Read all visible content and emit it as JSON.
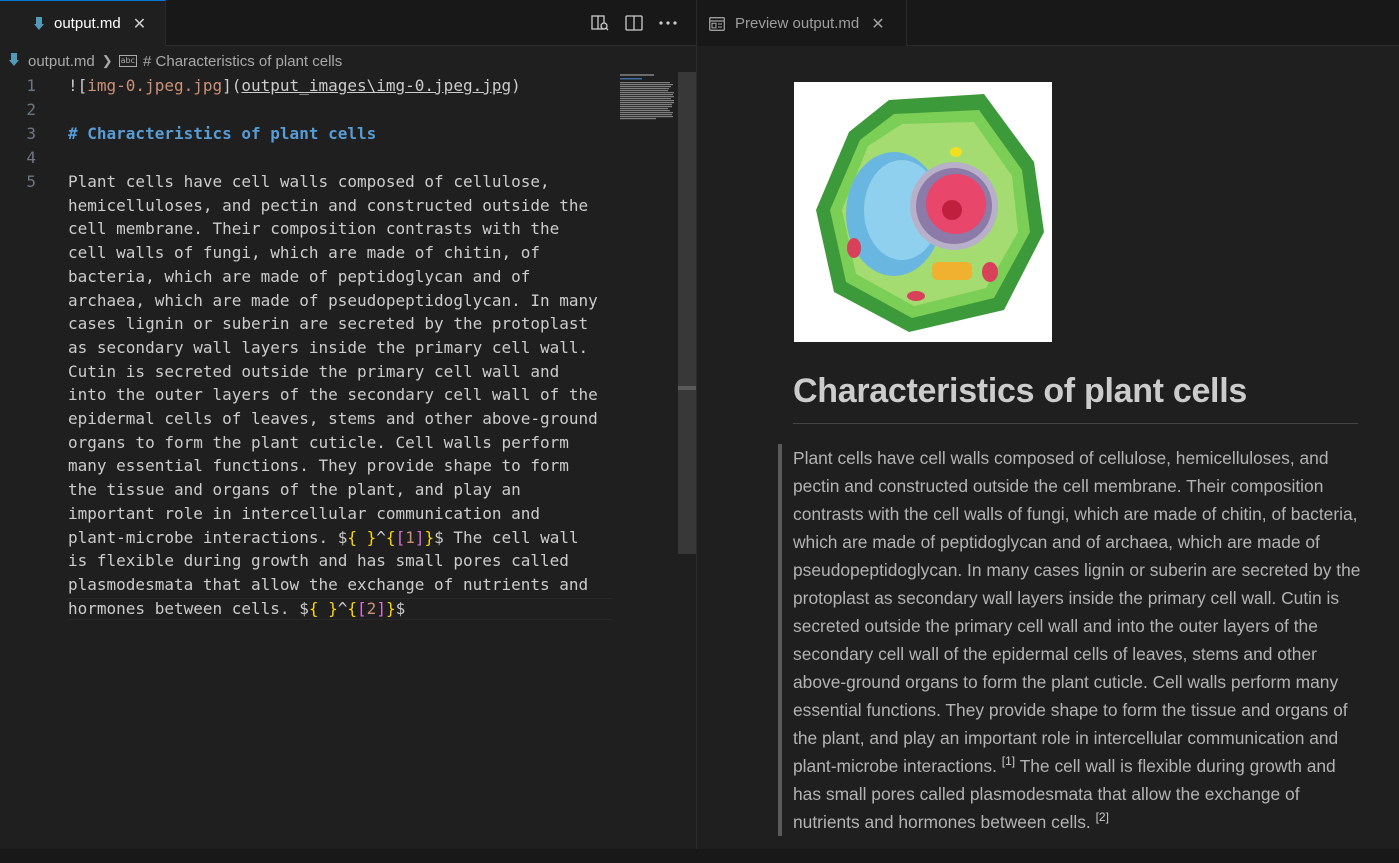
{
  "editor_tab": {
    "label": "output.md",
    "close": "✕"
  },
  "preview_tab": {
    "label": "Preview output.md",
    "close": "✕"
  },
  "breadcrumb": {
    "file": "output.md",
    "symbol": "# Characteristics of plant cells",
    "symbol_badge": "abc"
  },
  "editor": {
    "lines": [
      {
        "num": "1"
      },
      {
        "num": "2"
      },
      {
        "num": "3"
      },
      {
        "num": "4"
      },
      {
        "num": "5"
      }
    ],
    "line1": {
      "bang": "![",
      "alt": "img-0.jpeg.jpg",
      "mid": "](",
      "url": "output_images\\img-0.jpeg.jpg",
      "end": ")"
    },
    "line3": "# Characteristics of plant cells",
    "para": [
      "Plant cells have cell walls composed of cellulose,",
      "hemicelluloses, and pectin and constructed outside the",
      "cell membrane. Their composition contrasts with the",
      "cell walls of fungi, which are made of chitin, of",
      "bacteria, which are made of peptidoglycan and of",
      "archaea, which are made of pseudopeptidoglycan. In many",
      "cases lignin or suberin are secreted by the protoplast",
      "as secondary wall layers inside the primary cell wall.",
      "Cutin is secreted outside the primary cell wall and",
      "into the outer layers of the secondary cell wall of the",
      "epidermal cells of leaves, stems and other above-ground",
      "organs to form the plant cuticle. Cell walls perform",
      "many essential functions. They provide shape to form",
      "the tissue and organs of the plant, and play an",
      "important role in intercellular communication and"
    ],
    "fn1_prefix": "plant-microbe interactions. ",
    "fn1_dollar": "$",
    "fn1_open": "{",
    "fn1_close": "}",
    "fn1_caret": "^",
    "fn1_b1": "{",
    "fn1_lb": "[",
    "fn1_num": "1",
    "fn1_rb": "]",
    "fn1_b2": "}",
    "fn1_end": "$",
    "fn1_suffix": " The cell wall",
    "para2": [
      "is flexible during growth and has small pores called",
      "plasmodesmata that allow the exchange of nutrients and"
    ],
    "fn2_prefix": "hormones between cells. ",
    "fn2_num": "2"
  },
  "preview": {
    "title": "Characteristics of plant cells",
    "para_a": "Plant cells have cell walls composed of cellulose, hemicelluloses, and pectin and constructed outside the cell membrane. Their composition contrasts with the cell walls of fungi, which are made of chitin, of bacteria, which are made of peptidoglycan and of archaea, which are made of pseudopeptidoglycan. In many cases lignin or suberin are secreted by the protoplast as secondary wall layers inside the primary cell wall. Cutin is secreted outside the primary cell wall and into the outer layers of the secondary cell wall of the epidermal cells of leaves, stems and other above-ground organs to form the plant cuticle. Cell walls perform many essential functions. They provide shape to form the tissue and organs of the plant, and play an important role in intercellular communication and plant-microbe interactions. ",
    "sup1": "[1]",
    "para_b": " The cell wall is flexible during growth and has small pores called plasmodesmata that allow the exchange of nutrients and hormones between cells. ",
    "sup2": "[2]"
  },
  "colors": {
    "accent": "#0078d4",
    "md_icon": "#519aba",
    "heading": "#569cd6",
    "link_text": "#ce9178",
    "brace_yellow": "#ffd700",
    "brace_purple": "#da70d6"
  },
  "icons": [
    "markdown-file-icon",
    "open-changes-icon",
    "split-editor-icon",
    "more-actions-icon",
    "preview-icon",
    "close-icon",
    "chevron-right-icon",
    "symbol-string-icon"
  ]
}
